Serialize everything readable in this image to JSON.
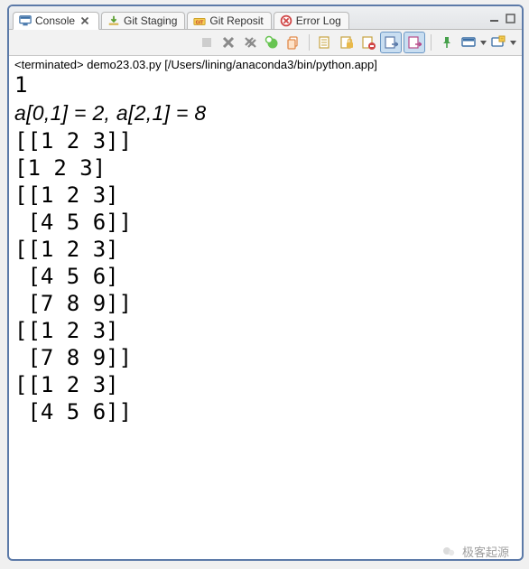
{
  "tabs": [
    {
      "id": "console",
      "label": "Console",
      "icon": "monitor-icon",
      "active": true,
      "closable": true
    },
    {
      "id": "git-staging",
      "label": "Git Staging",
      "icon": "download-icon",
      "active": false,
      "closable": false
    },
    {
      "id": "git-reposit",
      "label": "Git Reposit",
      "icon": "git-icon",
      "active": false,
      "closable": false
    },
    {
      "id": "error-log",
      "label": "Error Log",
      "icon": "error-icon",
      "active": false,
      "closable": false
    }
  ],
  "status": {
    "prefix": "<terminated>",
    "script": "demo23.03.py",
    "path": "[/Users/lining/anaconda3/bin/python.app]"
  },
  "console": {
    "lines": [
      "1",
      "a[0,1] = 2, a[2,1] = 8",
      "[[1 2 3]]",
      "[1 2 3]",
      "[[1 2 3]",
      " [4 5 6]]",
      "[[1 2 3]",
      " [4 5 6]",
      " [7 8 9]]",
      "[[1 2 3]",
      " [7 8 9]]",
      "[[1 2 3]",
      " [4 5 6]]"
    ]
  },
  "toolbar": {
    "stop_icon": "stop-icon",
    "remove_icon": "remove-launch-icon",
    "remove_all_icon": "remove-all-launches-icon",
    "clear_icon": "clear-console-icon",
    "scroll_lock_icon": "scroll-lock-icon",
    "word_wrap_icon": "word-wrap-icon",
    "pin_icon": "pin-icon",
    "display_icon": "display-selected-icon",
    "open_console_icon": "open-console-icon",
    "new_console_icon": "new-console-icon"
  },
  "watermark": "极客起源"
}
